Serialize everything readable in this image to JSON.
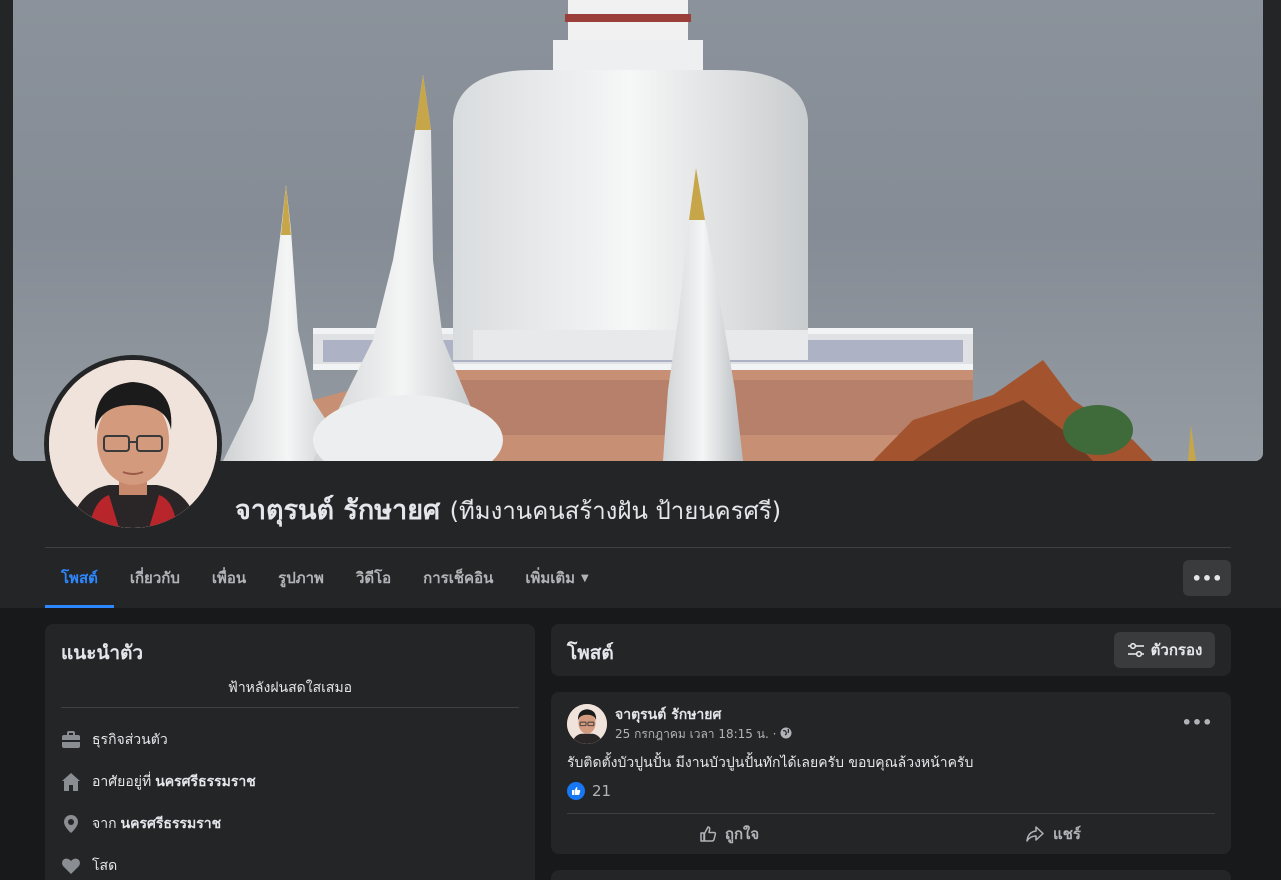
{
  "profile": {
    "name": "จาตุรนต์ รักษายศ",
    "alt_name": "(ทีมงานคนสร้างฝัน ป้ายนครศรี)"
  },
  "tabs": [
    {
      "label": "โพสต์",
      "active": true
    },
    {
      "label": "เกี่ยวกับ",
      "active": false
    },
    {
      "label": "เพื่อน",
      "active": false
    },
    {
      "label": "รูปภาพ",
      "active": false
    },
    {
      "label": "วิดีโอ",
      "active": false
    },
    {
      "label": "การเช็คอิน",
      "active": false
    },
    {
      "label": "เพิ่มเติม",
      "active": false
    }
  ],
  "more_icon": "ellipsis-icon",
  "intro": {
    "title": "แนะนำตัว",
    "bio": "ฟ้าหลังฝนสดใสเสมอ",
    "items": [
      {
        "icon": "briefcase-icon",
        "text": "ธุรกิจส่วนตัว",
        "bold": ""
      },
      {
        "icon": "home-icon",
        "text": "อาศัยอยู่ที่",
        "bold": "นครศรีธรรมราช"
      },
      {
        "icon": "location-pin-icon",
        "text": "จาก",
        "bold": "นครศรีธรรมราช"
      },
      {
        "icon": "heart-icon",
        "text": "โสด",
        "bold": ""
      }
    ]
  },
  "posts_header": {
    "title": "โพสต์",
    "filter_label": "ตัวกรอง"
  },
  "post": {
    "author": "จาตุรนต์ รักษายศ",
    "timestamp": "25 กรกฎาคม เวลา 18:15 น. ·",
    "text": "รับติดตั้งบัวปูนปั้น มีงานบัวปูนปั้นทักได้เลยครับ  ขอบคุณล้วงหน้าครับ",
    "like_count": "21",
    "like_label": "ถูกใจ",
    "share_label": "แชร์"
  },
  "colors": {
    "accent": "#2d88ff",
    "card": "#242526",
    "page": "#18191a",
    "like_badge": "#1877f2"
  }
}
